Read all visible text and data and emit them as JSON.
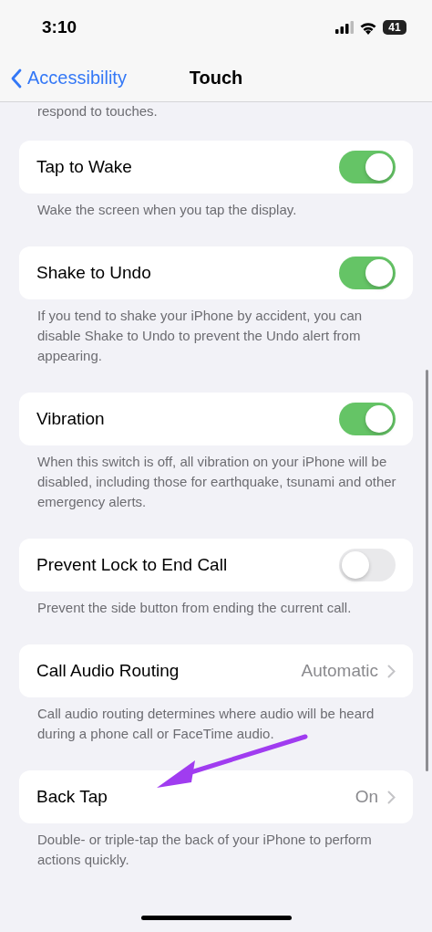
{
  "status_bar": {
    "time": "3:10",
    "battery": "41"
  },
  "nav": {
    "back": "Accessibility",
    "title": "Touch"
  },
  "cut_footer": "respond to touches.",
  "settings": [
    {
      "kind": "toggle",
      "label": "Tap to Wake",
      "on": true,
      "footer": "Wake the screen when you tap the display."
    },
    {
      "kind": "toggle",
      "label": "Shake to Undo",
      "on": true,
      "footer": "If you tend to shake your iPhone by accident, you can disable Shake to Undo to prevent the Undo alert from appearing."
    },
    {
      "kind": "toggle",
      "label": "Vibration",
      "on": true,
      "footer": "When this switch is off, all vibration on your iPhone will be disabled, including those for earthquake, tsunami and other emergency alerts."
    },
    {
      "kind": "toggle",
      "label": "Prevent Lock to End Call",
      "on": false,
      "footer": "Prevent the side button from ending the current call."
    },
    {
      "kind": "link",
      "label": "Call Audio Routing",
      "value": "Automatic",
      "footer": "Call audio routing determines where audio will be heard during a phone call or FaceTime audio."
    },
    {
      "kind": "link",
      "label": "Back Tap",
      "value": "On",
      "footer": "Double- or triple-tap the back of your iPhone to perform actions quickly."
    }
  ]
}
